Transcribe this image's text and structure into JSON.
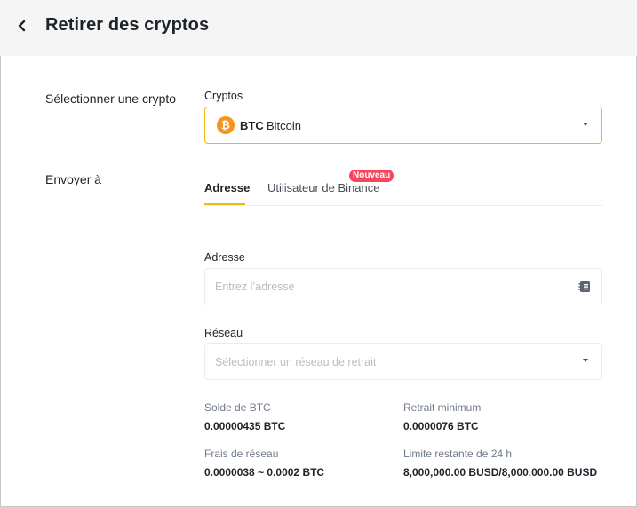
{
  "header": {
    "title": "Retirer des cryptos"
  },
  "rows": {
    "select_crypto_label": "Sélectionner une crypto",
    "send_to_label": "Envoyer à"
  },
  "crypto": {
    "field_label": "Cryptos",
    "ticker": "BTC",
    "name": "Bitcoin",
    "icon_glyph": "₿",
    "icon_color": "#f7931a"
  },
  "tabs": {
    "address": "Adresse",
    "binance_user": "Utilisateur de Binance",
    "new_badge": "Nouveau"
  },
  "address": {
    "label": "Adresse",
    "placeholder": "Entrez l’adresse"
  },
  "network": {
    "label": "Réseau",
    "placeholder": "Sélectionner un réseau de retrait"
  },
  "info": {
    "balance_label": "Solde de BTC",
    "balance_value": "0.00000435 BTC",
    "min_withdraw_label": "Retrait minimum",
    "min_withdraw_value": "0.0000076 BTC",
    "fee_label": "Frais de réseau",
    "fee_value": "0.0000038 ~ 0.0002 BTC",
    "limit_label": "Limite restante de 24 h",
    "limit_value": "8,000,000.00 BUSD/8,000,000.00 BUSD"
  },
  "colors": {
    "accent": "#f0b90b",
    "badge": "#f6465d",
    "header_bg": "#f5f5f5"
  }
}
